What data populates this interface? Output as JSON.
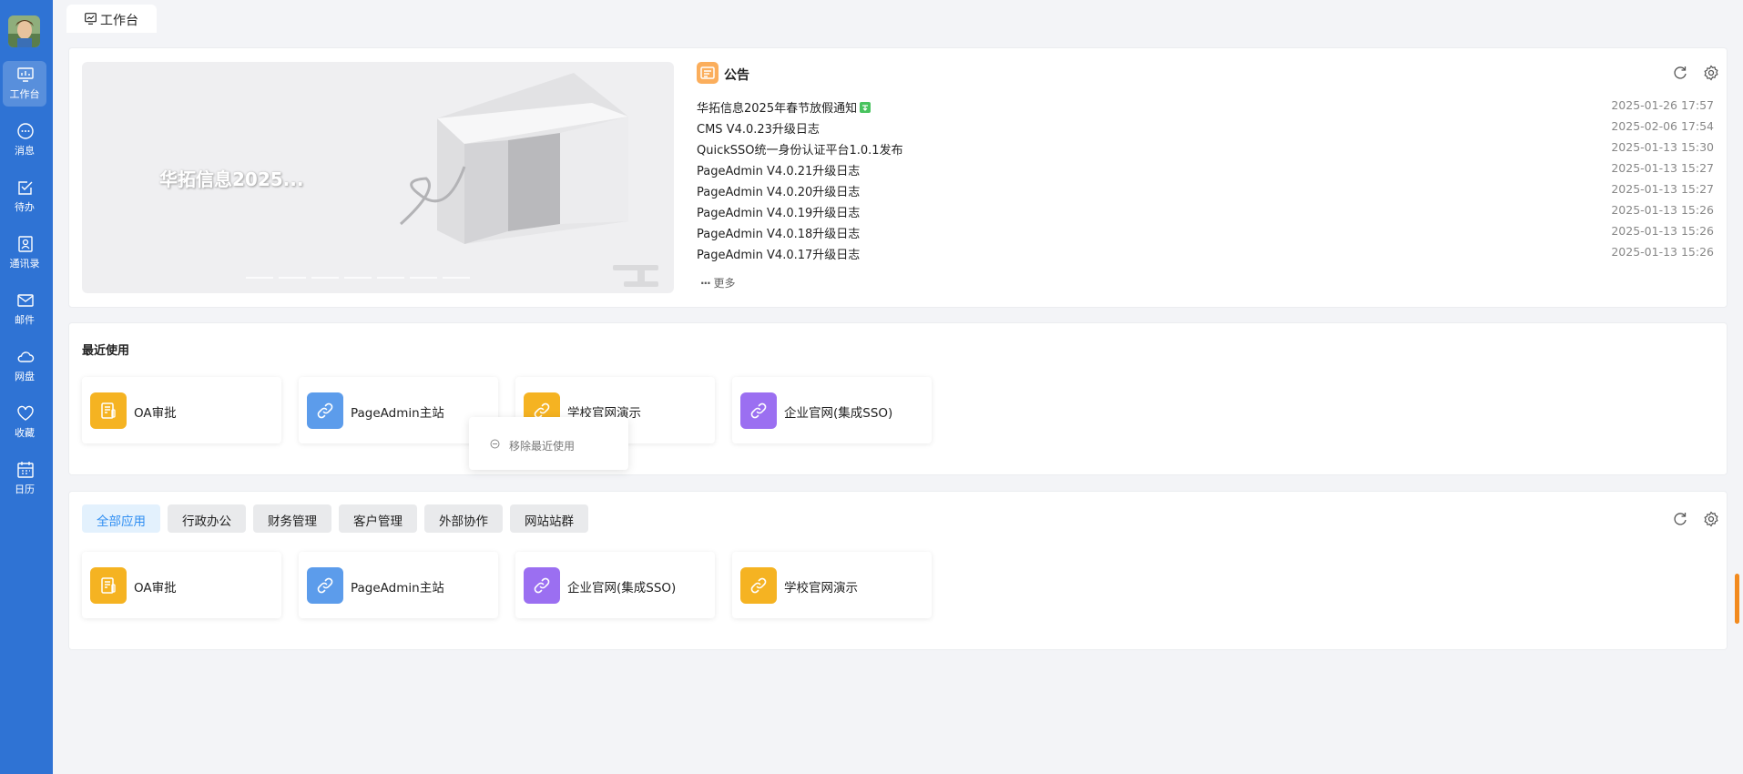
{
  "sidebar": {
    "items": [
      {
        "label": "工作台",
        "icon": "dashboard-icon",
        "active": true
      },
      {
        "label": "消息",
        "icon": "message-icon"
      },
      {
        "label": "待办",
        "icon": "todo-icon"
      },
      {
        "label": "通讯录",
        "icon": "contacts-icon"
      },
      {
        "label": "邮件",
        "icon": "mail-icon"
      },
      {
        "label": "网盘",
        "icon": "cloud-icon"
      },
      {
        "label": "收藏",
        "icon": "heart-icon"
      },
      {
        "label": "日历",
        "icon": "calendar-icon"
      }
    ]
  },
  "tabs": [
    {
      "label": "工作台",
      "icon": "dashboard-icon"
    }
  ],
  "banner": {
    "text": "华拓信息2025..."
  },
  "notice": {
    "title": "公告",
    "items": [
      {
        "title": "华拓信息2025年春节放假通知",
        "date": "2025-01-26 17:57",
        "new": true
      },
      {
        "title": "CMS V4.0.23升级日志",
        "date": "2025-02-06 17:54"
      },
      {
        "title": "QuickSSO统一身份认证平台1.0.1发布",
        "date": "2025-01-13 15:30"
      },
      {
        "title": "PageAdmin V4.0.21升级日志",
        "date": "2025-01-13 15:27"
      },
      {
        "title": "PageAdmin V4.0.20升级日志",
        "date": "2025-01-13 15:27"
      },
      {
        "title": "PageAdmin V4.0.19升级日志",
        "date": "2025-01-13 15:26"
      },
      {
        "title": "PageAdmin V4.0.18升级日志",
        "date": "2025-01-13 15:26"
      },
      {
        "title": "PageAdmin V4.0.17升级日志",
        "date": "2025-01-13 15:26"
      }
    ],
    "more_label": "更多"
  },
  "recent": {
    "title": "最近使用",
    "apps": [
      {
        "label": "OA审批",
        "color": "#f5b322",
        "icon": "document-icon"
      },
      {
        "label": "PageAdmin主站",
        "color": "#5c9ceb",
        "icon": "link-icon"
      },
      {
        "label": "学校官网演示",
        "color": "#f5b322",
        "icon": "link-icon"
      },
      {
        "label": "企业官网(集成SSO)",
        "color": "#9b6ff1",
        "icon": "link-icon"
      }
    ],
    "context_menu": {
      "item": "移除最近使用"
    }
  },
  "all_apps": {
    "categories": [
      "全部应用",
      "行政办公",
      "财务管理",
      "客户管理",
      "外部协作",
      "网站站群"
    ],
    "active_category": "全部应用",
    "apps": [
      {
        "label": "OA审批",
        "color": "#f5b322",
        "icon": "document-icon"
      },
      {
        "label": "PageAdmin主站",
        "color": "#5c9ceb",
        "icon": "link-icon"
      },
      {
        "label": "企业官网(集成SSO)",
        "color": "#9b6ff1",
        "icon": "link-icon"
      },
      {
        "label": "学校官网演示",
        "color": "#f5b322",
        "icon": "link-icon"
      }
    ]
  },
  "colors": {
    "sidebar": "#2f73d4",
    "accent": "#2f8ef2",
    "orange": "#f5b322",
    "blue": "#5c9ceb",
    "purple": "#9b6ff1"
  }
}
